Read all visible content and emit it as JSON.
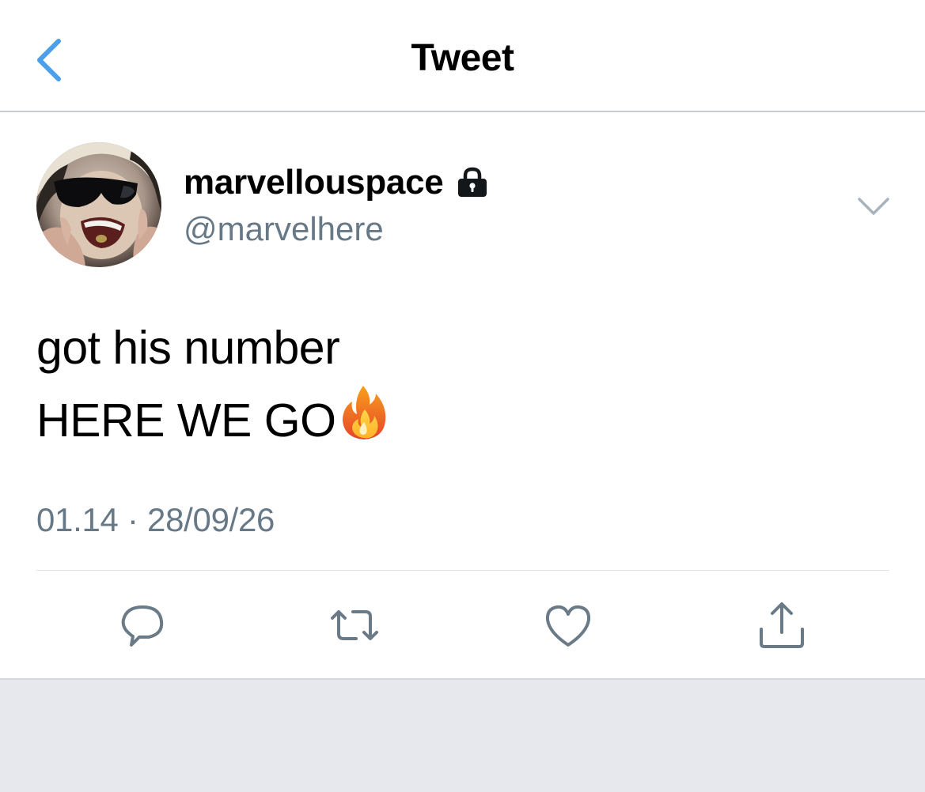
{
  "header": {
    "title": "Tweet",
    "back_icon": "chevron-left-icon"
  },
  "tweet": {
    "author": {
      "display_name": "marvellouspace",
      "handle": "@marvelhere",
      "protected_icon": "lock-icon"
    },
    "text_lines": [
      "got his number",
      "HERE WE GO"
    ],
    "emoji": "fire-emoji",
    "timestamp": "01.14 · 28/09/26",
    "actions": [
      {
        "name": "reply",
        "icon": "reply-icon"
      },
      {
        "name": "retweet",
        "icon": "retweet-icon"
      },
      {
        "name": "like",
        "icon": "heart-icon"
      },
      {
        "name": "share",
        "icon": "share-icon"
      }
    ]
  },
  "colors": {
    "accent": "#4a9eea",
    "secondary_text": "#677886",
    "icon_gray": "#6b7a87",
    "background": "#e6e8ee"
  }
}
